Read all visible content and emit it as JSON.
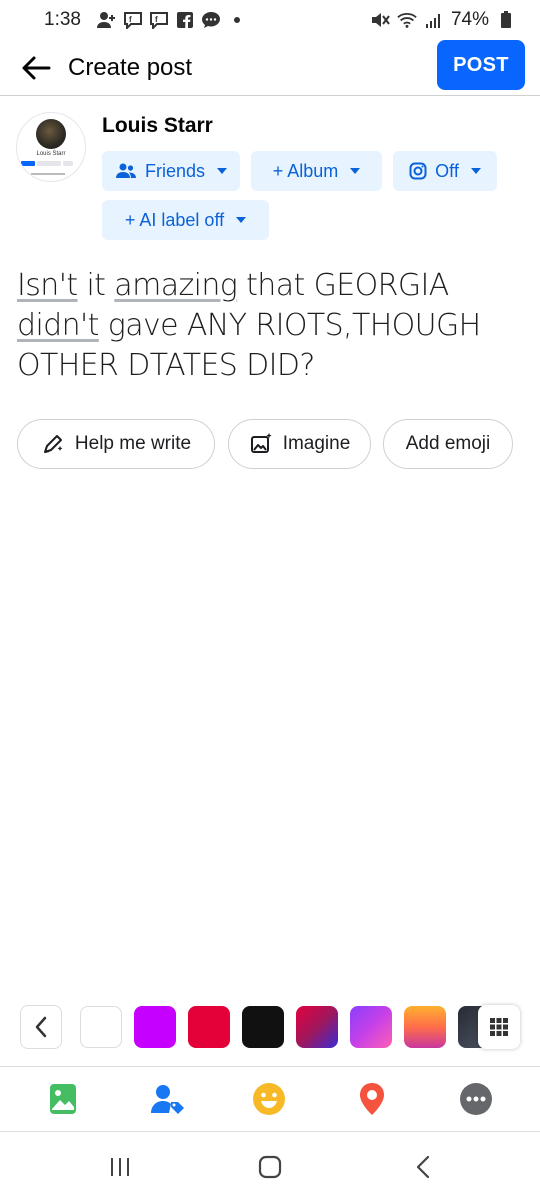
{
  "status_bar": {
    "time": "1:38",
    "battery": "74%",
    "icons": [
      "person-add-icon",
      "messenger-icon",
      "messenger-icon",
      "facebook-icon",
      "chat-icon",
      "dot-icon",
      "mute-icon",
      "wifi-icon",
      "signal-icon",
      "battery-icon"
    ]
  },
  "header": {
    "title": "Create post",
    "post_label": "POST"
  },
  "composer": {
    "user_name": "Louis Starr",
    "avatar_caption": "Louis Starr",
    "audience_label": "Friends",
    "album_label": "+ Album",
    "instagram_label": "Off",
    "ai_label": "+ AI label off"
  },
  "post": {
    "text_parts": [
      "Isn't",
      " it ",
      "amazing",
      " that GEORGIA ",
      "didn't",
      " gave ANY RIOTS,THOUGH OTHER DTATES DID?"
    ]
  },
  "suggestions": {
    "help_me_write": "Help me write",
    "imagine": "Imagine",
    "add_emoji": "Add emoji"
  },
  "colors": {
    "accent": "#0866ff",
    "pill_bg": "#e7f3ff",
    "pill_text": "#0a62d8",
    "swatches": [
      "#ffffff",
      "#c600ff",
      "#e40039",
      "#111111",
      "gradient-red-purple",
      "gradient-purple-pink",
      "gradient-orange-pink",
      "gradient-dark"
    ]
  },
  "toolbar": {
    "items": [
      "photo-icon",
      "tag-people-icon",
      "feeling-icon",
      "check-in-icon",
      "more-icon"
    ]
  },
  "navbar": {
    "items": [
      "recents-icon",
      "home-icon",
      "back-icon"
    ]
  }
}
